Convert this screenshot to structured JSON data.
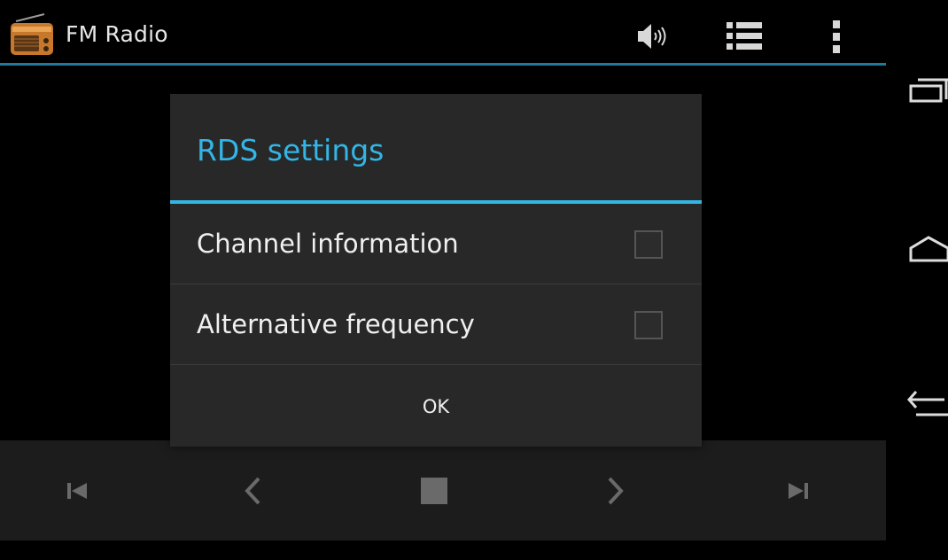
{
  "app": {
    "title": "FM Radio"
  },
  "action_bar": {
    "icons": [
      "radio-icon",
      "speaker-icon",
      "list-icon",
      "overflow-menu-icon"
    ]
  },
  "dialog": {
    "title": "RDS settings",
    "options": [
      {
        "label": "Channel information",
        "checked": false
      },
      {
        "label": "Alternative frequency",
        "checked": false
      }
    ],
    "ok_label": "OK"
  },
  "controls": {
    "icons": [
      "skip-previous-icon",
      "seek-back-icon",
      "stop-icon",
      "seek-forward-icon",
      "skip-next-icon"
    ]
  },
  "navigation": {
    "icons": [
      "recent-apps-icon",
      "home-icon",
      "back-icon"
    ]
  },
  "colors": {
    "accent": "#33b5e5",
    "action_bar_underline": "#217a9e",
    "dialog_bg": "#282828",
    "control_bar_bg": "#1c1c1c"
  }
}
